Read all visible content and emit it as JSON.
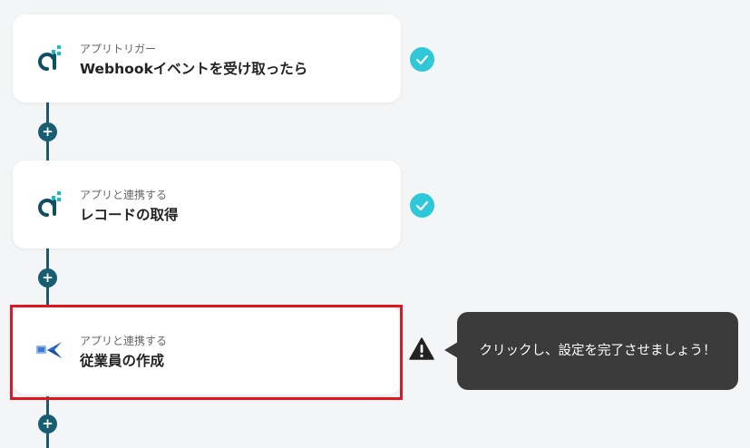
{
  "flow": {
    "steps": [
      {
        "subtitle": "アプリトリガー",
        "title": "Webhookイベントを受け取ったら",
        "app_icon": "yoom-d-icon",
        "status": "completed"
      },
      {
        "subtitle": "アプリと連携する",
        "title": "レコードの取得",
        "app_icon": "yoom-d-icon",
        "status": "completed"
      },
      {
        "subtitle": "アプリと連携する",
        "title": "従業員の作成",
        "app_icon": "employee-app-icon",
        "status": "warning"
      }
    ],
    "add_button_label": "+",
    "tooltip": "クリックし、設定を完了させましょう！"
  },
  "colors": {
    "connector": "#1e5a6e",
    "add_button": "#175e73",
    "check": "#2ec8d8",
    "highlight": "#e3151e",
    "tooltip_bg": "#3b3b3b"
  }
}
